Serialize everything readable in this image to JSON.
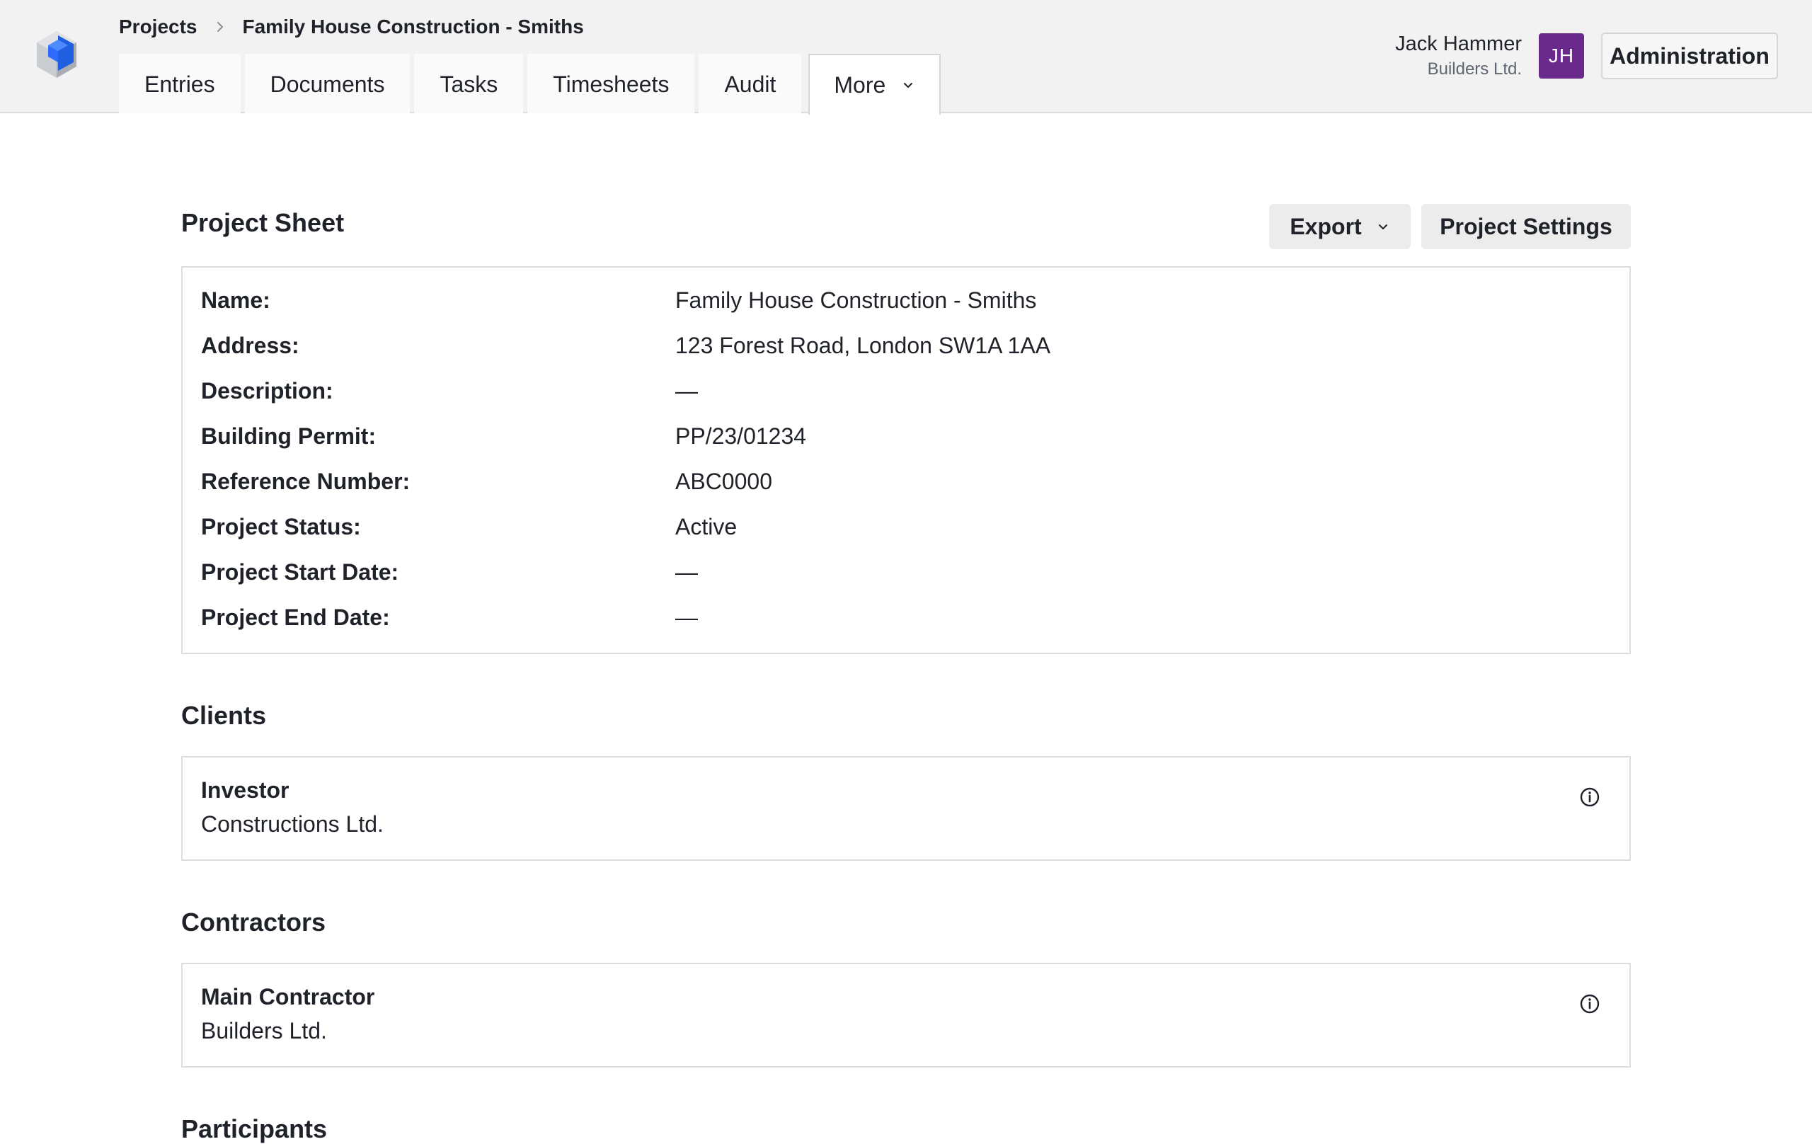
{
  "breadcrumb": {
    "root": "Projects",
    "current": "Family House Construction - Smiths"
  },
  "tabs": [
    {
      "label": "Entries"
    },
    {
      "label": "Documents"
    },
    {
      "label": "Tasks"
    },
    {
      "label": "Timesheets"
    },
    {
      "label": "Audit"
    },
    {
      "label": "More",
      "active": true
    }
  ],
  "user": {
    "name": "Jack Hammer",
    "org": "Builders Ltd.",
    "initials": "JH",
    "avatar_color": "#6a2a8c"
  },
  "header": {
    "admin_label": "Administration"
  },
  "project_sheet": {
    "title": "Project Sheet",
    "export_label": "Export",
    "settings_label": "Project Settings",
    "fields": [
      {
        "key": "Name:",
        "value": "Family House Construction - Smiths"
      },
      {
        "key": "Address:",
        "value": "123 Forest Road, London SW1A 1AA"
      },
      {
        "key": "Description:",
        "value": "—"
      },
      {
        "key": "Building Permit:",
        "value": "PP/23/01234"
      },
      {
        "key": "Reference Number:",
        "value": "ABC0000"
      },
      {
        "key": "Project Status:",
        "value": "Active"
      },
      {
        "key": "Project Start Date:",
        "value": "—"
      },
      {
        "key": "Project End Date:",
        "value": "—"
      }
    ]
  },
  "clients": {
    "title": "Clients",
    "items": [
      {
        "role": "Investor",
        "name": "Constructions Ltd."
      }
    ]
  },
  "contractors": {
    "title": "Contractors",
    "items": [
      {
        "role": "Main Contractor",
        "name": "Builders Ltd."
      }
    ]
  },
  "participants": {
    "title": "Participants"
  },
  "icons": {
    "logo": "cube-logo-icon",
    "breadcrumb_sep": "chevron-right-icon",
    "dropdown": "chevron-down-icon",
    "info": "info-circle-icon"
  },
  "colors": {
    "accent": "#2f6bff",
    "header_bg": "#f2f2f2"
  }
}
